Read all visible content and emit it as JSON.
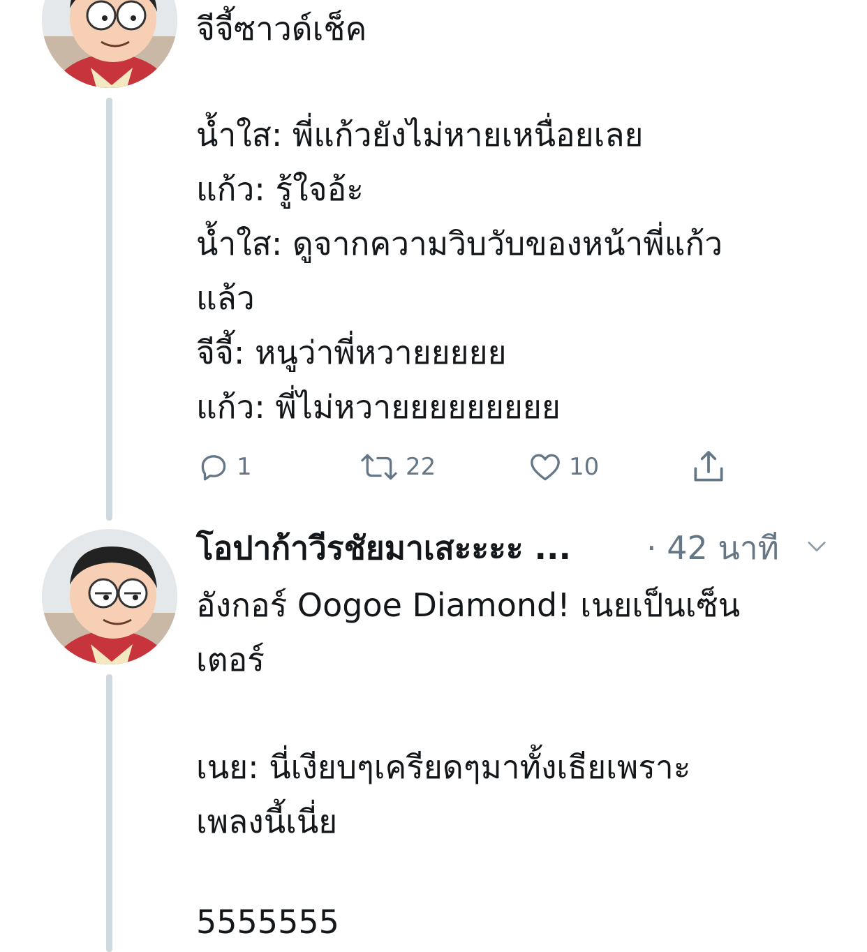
{
  "tweet1": {
    "lines": [
      "จีจี้ซาวด์เช็ค",
      "",
      "น้ำใส: พี่แก้วยังไม่หายเหนื่อยเลย",
      "แก้ว: รู้ใจอ้ะ",
      "น้ำใส: ดูจากความวิบวับของหน้าพี่แก้ว",
      "แล้ว",
      "จีจี้: หนูว่าพี่หวายยยยย",
      "แก้ว: พี่ไม่หวายยยยยยยยย"
    ],
    "actions": {
      "reply_icon": "reply-icon",
      "reply_count": "1",
      "retweet_icon": "retweet-icon",
      "retweet_count": "22",
      "like_icon": "heart-icon",
      "like_count": "10",
      "share_icon": "share-icon"
    }
  },
  "tweet2": {
    "author_name": "โอปาก้าวีรชัยมาเสะะะะ ...",
    "timestamp": "· 42 นาที",
    "menu_icon": "chevron-down-icon",
    "lines": [
      "อังกอร์ Oogoe Diamond! เนยเป็นเซ็น",
      "เตอร์",
      "",
      "เนย: นี่เงียบๆเครียดๆมาทั้งเธียเพราะ",
      "เพลงนี้เนี่ย",
      "",
      "5555555"
    ]
  },
  "colors": {
    "text": "#14171a",
    "secondary": "#657786",
    "thread_line": "#cfd9de"
  }
}
